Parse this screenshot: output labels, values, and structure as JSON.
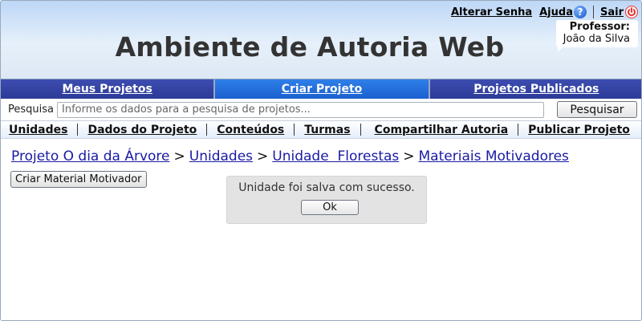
{
  "header": {
    "title": "Ambiente de Autoria Web",
    "links": {
      "change_password": "Alterar Senha",
      "help": "Ajuda",
      "logout": "Sair"
    },
    "icons": {
      "help": "help-icon",
      "logout": "power-icon"
    },
    "user": {
      "role": "Professor:",
      "name": "João da Silva"
    }
  },
  "nav": {
    "tabs": [
      {
        "label": "Meus Projetos",
        "active": false
      },
      {
        "label": "Criar Projeto",
        "active": true
      },
      {
        "label": "Projetos Publicados",
        "active": false
      }
    ]
  },
  "search": {
    "label": "Pesquisa",
    "placeholder": "Informe os dados para a pesquisa de projetos...",
    "value": "",
    "button": "Pesquisar"
  },
  "subnav": {
    "items": [
      "Unidades",
      "Dados do Projeto",
      "Conteúdos",
      "Turmas",
      "Compartilhar Autoria",
      "Publicar Projeto"
    ]
  },
  "breadcrumb": {
    "items": [
      "Projeto O dia da Árvore",
      "Unidades",
      "Unidade  Florestas",
      "Materiais Motivadores"
    ],
    "separator": ">"
  },
  "content": {
    "create_button": "Criar Material Motivador"
  },
  "message": {
    "text": "Unidade foi salva com sucesso.",
    "ok_button": "Ok"
  },
  "colors": {
    "nav_tab": "#2c3a98",
    "nav_tab_active": "#1b5fcf",
    "link": "#1a1aa6",
    "title": "#333333"
  }
}
